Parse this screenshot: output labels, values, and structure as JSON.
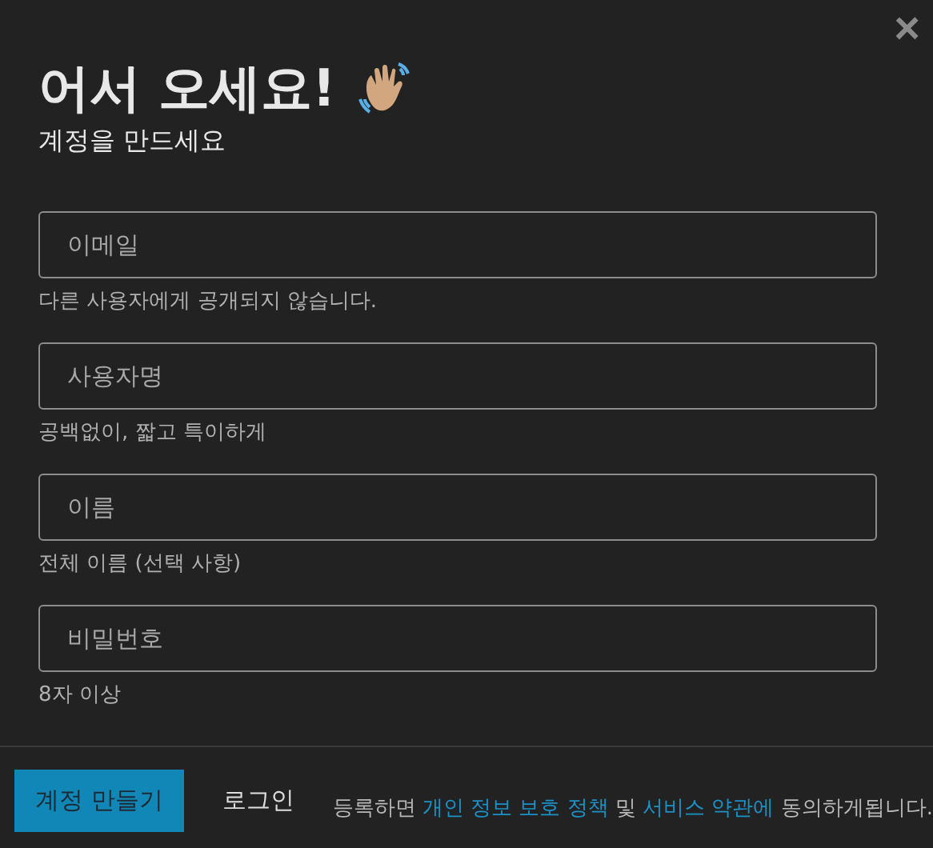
{
  "close_button": {
    "label": "×"
  },
  "title": "어서 오세요!",
  "subtitle": "계정을 만드세요",
  "fields": [
    {
      "placeholder": "이메일",
      "hint": "다른 사용자에게 공개되지 않습니다."
    },
    {
      "placeholder": "사용자명",
      "hint": "공백없이, 짧고 특이하게"
    },
    {
      "placeholder": "이름",
      "hint": "전체 이름 (선택 사항)"
    },
    {
      "placeholder": "비밀번호",
      "hint": "8자 이상"
    }
  ],
  "footer": {
    "primary_button": "계정 만들기",
    "secondary_button": "로그인",
    "notice": [
      {
        "kind": "text",
        "text": "등록하면 "
      },
      {
        "kind": "link",
        "text": "개인 정보 보호 정책"
      },
      {
        "kind": "text",
        "text": " 및 "
      },
      {
        "kind": "link",
        "text": "서비스 약관에"
      },
      {
        "kind": "text",
        "text": " 동의하게됩니다."
      }
    ]
  }
}
